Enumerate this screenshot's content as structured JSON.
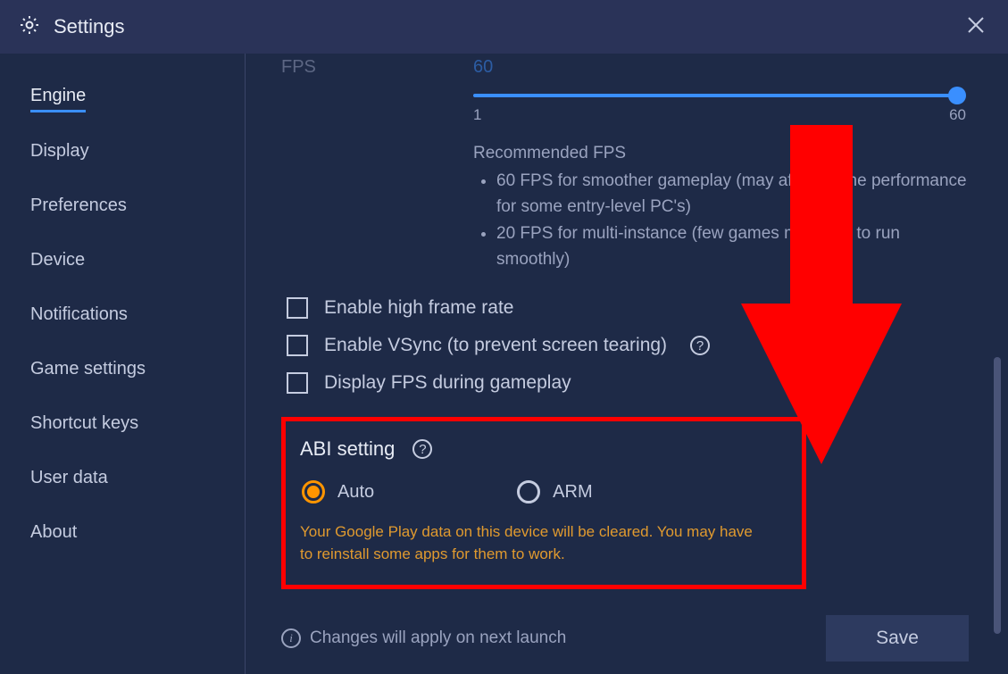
{
  "header": {
    "title": "Settings"
  },
  "sidebar": {
    "items": [
      {
        "label": "Engine",
        "active": true
      },
      {
        "label": "Display",
        "active": false
      },
      {
        "label": "Preferences",
        "active": false
      },
      {
        "label": "Device",
        "active": false
      },
      {
        "label": "Notifications",
        "active": false
      },
      {
        "label": "Game settings",
        "active": false
      },
      {
        "label": "Shortcut keys",
        "active": false
      },
      {
        "label": "User data",
        "active": false
      },
      {
        "label": "About",
        "active": false
      }
    ]
  },
  "engine": {
    "fps": {
      "label": "FPS",
      "value": "60",
      "slider_min": "1",
      "slider_max": "60",
      "rec_title": "Recommended FPS",
      "rec_items": [
        "60 FPS for smoother gameplay (may affect game performance for some entry-level PC's)",
        "20 FPS for multi-instance (few games might fail to run smoothly)"
      ]
    },
    "checkboxes": [
      {
        "label": "Enable high frame rate",
        "help": false
      },
      {
        "label": "Enable VSync (to prevent screen tearing)",
        "help": true
      },
      {
        "label": "Display FPS during gameplay",
        "help": false
      }
    ],
    "abi": {
      "title": "ABI setting",
      "options": [
        {
          "label": "Auto",
          "selected": true
        },
        {
          "label": "ARM",
          "selected": false
        }
      ],
      "warning": "Your Google Play data on this device will be cleared. You may have to reinstall some apps for them to work."
    }
  },
  "footer": {
    "notice": "Changes will apply on next launch",
    "save_label": "Save"
  },
  "colors": {
    "accent": "#3a8fff",
    "warning": "#e09a2f",
    "highlight": "#ff0000"
  }
}
